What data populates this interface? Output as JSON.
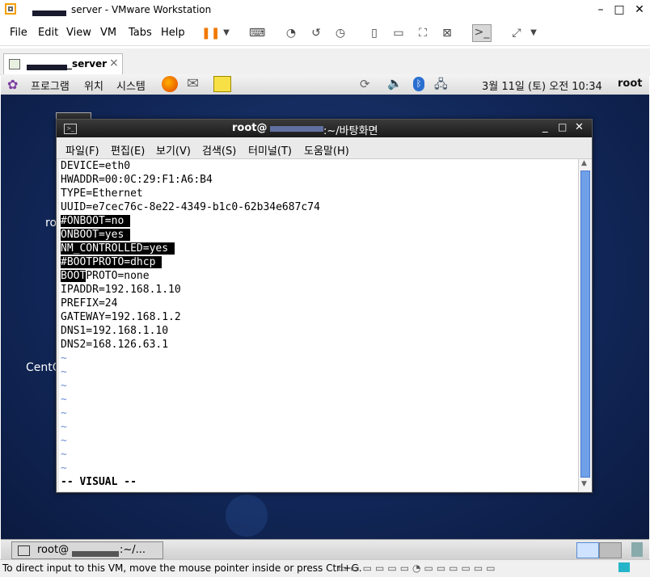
{
  "vmware": {
    "window_title": "server - VMware Workstation",
    "menu": [
      "File",
      "Edit",
      "View",
      "VM",
      "Tabs",
      "Help"
    ],
    "tab_label": "_server",
    "tab_close": "×",
    "win_minimize": "–",
    "win_maximize": "□",
    "win_close": "✕"
  },
  "gnome": {
    "menus": [
      "프로그램",
      "위치",
      "시스템"
    ],
    "clock": "3월 11일 (토) 오전 10:34",
    "user": "root"
  },
  "desktop": {
    "labels": [
      "ro",
      "CentO"
    ]
  },
  "terminal": {
    "title_prefix": "root@",
    "title_suffix": ":~/바탕화면",
    "menu": [
      "파일(F)",
      "편집(E)",
      "보기(V)",
      "검색(S)",
      "터미널(T)",
      "도움말(H)"
    ],
    "lines": [
      {
        "text": "DEVICE=eth0"
      },
      {
        "text": "HWADDR=00:0C:29:F1:A6:B4"
      },
      {
        "text": "TYPE=Ethernet"
      },
      {
        "text": "UUID=e7cec76c-8e22-4349-b1c0-62b34e687c74"
      },
      {
        "text": "#ONBOOT=no"
      },
      {
        "text": "ONBOOT=yes"
      },
      {
        "text": "NM_CONTROLLED=yes"
      },
      {
        "text": "#BOOTPROTO=dhcp"
      },
      {
        "text": "BOOT",
        "rest": "PROTO=none"
      },
      {
        "text": "IPADDR=192.168.1.10"
      },
      {
        "text": "PREFIX=24"
      },
      {
        "text": "GATEWAY=192.168.1.2"
      },
      {
        "text": "DNS1=192.168.1.10"
      },
      {
        "text": "DNS2=168.126.63.1"
      }
    ],
    "tilde": "~",
    "mode": "-- VISUAL --"
  },
  "taskbar": {
    "item_prefix": "root@",
    "item_suffix": ":~/..."
  },
  "statusbar": {
    "message": "To direct input to this VM, move the mouse pointer inside or press Ctrl+G."
  }
}
